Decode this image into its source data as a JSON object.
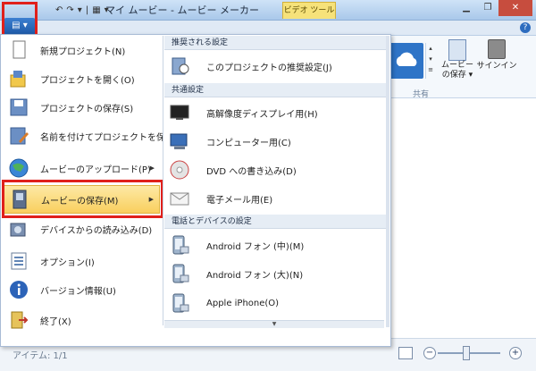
{
  "title_bar": {
    "title": "マイ ムービー - ムービー メーカー",
    "context_tab": "ビデオ ツール"
  },
  "ribbon": {
    "save_movie_label": "ムービー\nの保存 ▾",
    "signin_label": "サインイン",
    "group_share": "共有"
  },
  "file_menu": {
    "items": [
      {
        "label": "新規プロジェクト(N)",
        "icon": "new-project-icon"
      },
      {
        "label": "プロジェクトを開く(O)",
        "icon": "open-project-icon"
      },
      {
        "label": "プロジェクトの保存(S)",
        "icon": "save-project-icon"
      },
      {
        "label": "名前を付けてプロジェクトを保存(A)",
        "icon": "save-as-icon"
      },
      {
        "label": "ムービーのアップロード(P)",
        "icon": "upload-globe-icon",
        "has_submenu": true
      },
      {
        "label": "ムービーの保存(M)",
        "icon": "save-movie-icon",
        "has_submenu": true,
        "selected": true
      },
      {
        "label": "デバイスからの読み込み(D)",
        "icon": "import-device-icon"
      },
      {
        "label": "オプション(I)",
        "icon": "options-icon"
      },
      {
        "label": "バージョン情報(U)",
        "icon": "info-icon"
      },
      {
        "label": "終了(X)",
        "icon": "exit-icon"
      }
    ]
  },
  "save_movie_submenu": {
    "section1": "推奨される設定",
    "recommended": "このプロジェクトの推奨設定(J)",
    "section2": "共通設定",
    "common": [
      {
        "label": "高解像度ディスプレイ用(H)",
        "icon": "hd-display-icon"
      },
      {
        "label": "コンピューター用(C)",
        "icon": "computer-icon"
      },
      {
        "label": "DVD への書き込み(D)",
        "icon": "dvd-icon"
      },
      {
        "label": "電子メール用(E)",
        "icon": "email-icon"
      }
    ],
    "section3": "電話とデバイスの設定",
    "devices": [
      {
        "label": "Android フォン (中)(M)",
        "icon": "android-phone-icon"
      },
      {
        "label": "Android フォン (大)(N)",
        "icon": "android-phone-icon"
      },
      {
        "label": "Apple iPhone(O)",
        "icon": "iphone-icon"
      }
    ]
  },
  "status_bar": {
    "items_text": "アイテム: 1/1"
  }
}
